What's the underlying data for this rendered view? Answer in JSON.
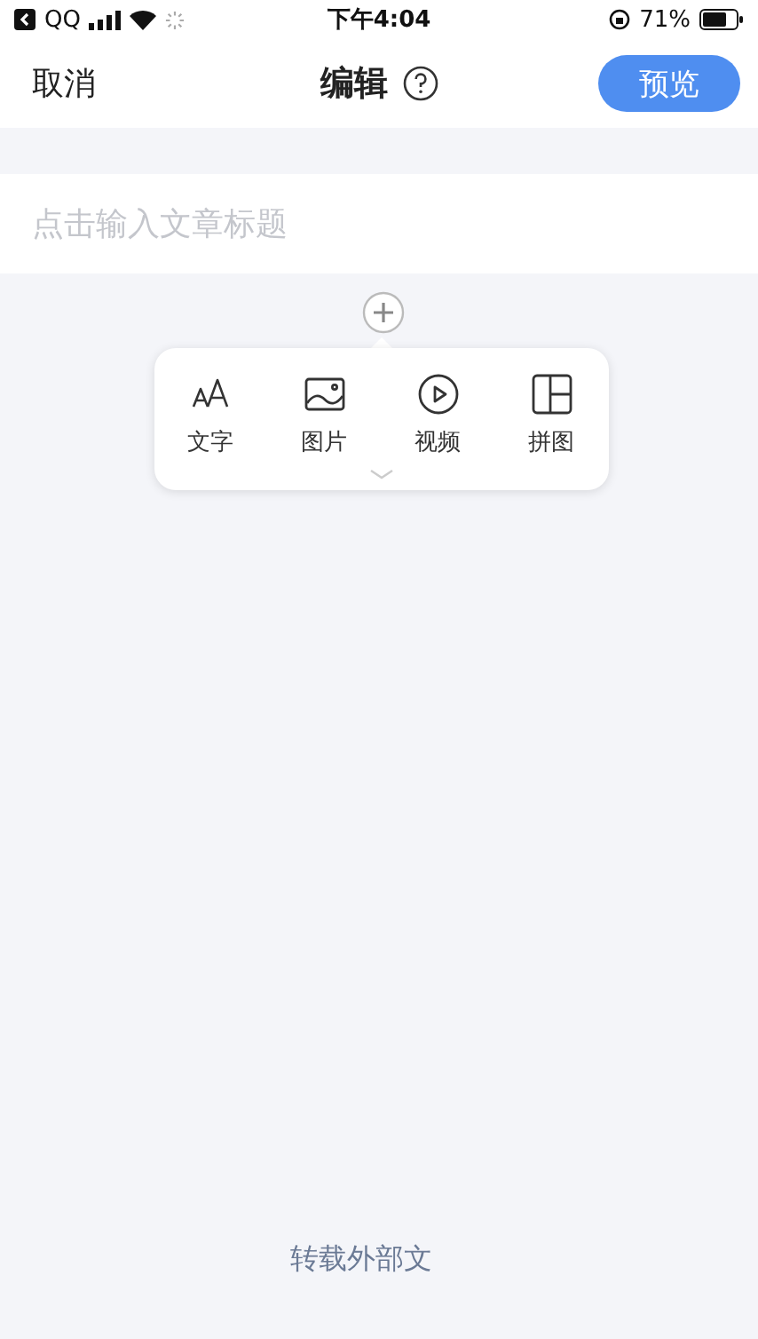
{
  "status_bar": {
    "back_app": "QQ",
    "time": "下午4:04",
    "battery": "71%"
  },
  "nav": {
    "cancel": "取消",
    "title": "编辑",
    "preview": "预览"
  },
  "title_field": {
    "placeholder": "点击输入文章标题"
  },
  "insert_menu": [
    {
      "kind": "text",
      "label": "文字"
    },
    {
      "kind": "image",
      "label": "图片"
    },
    {
      "kind": "video",
      "label": "视频"
    },
    {
      "kind": "collage",
      "label": "拼图"
    }
  ],
  "bottom_link": "转载外部文"
}
